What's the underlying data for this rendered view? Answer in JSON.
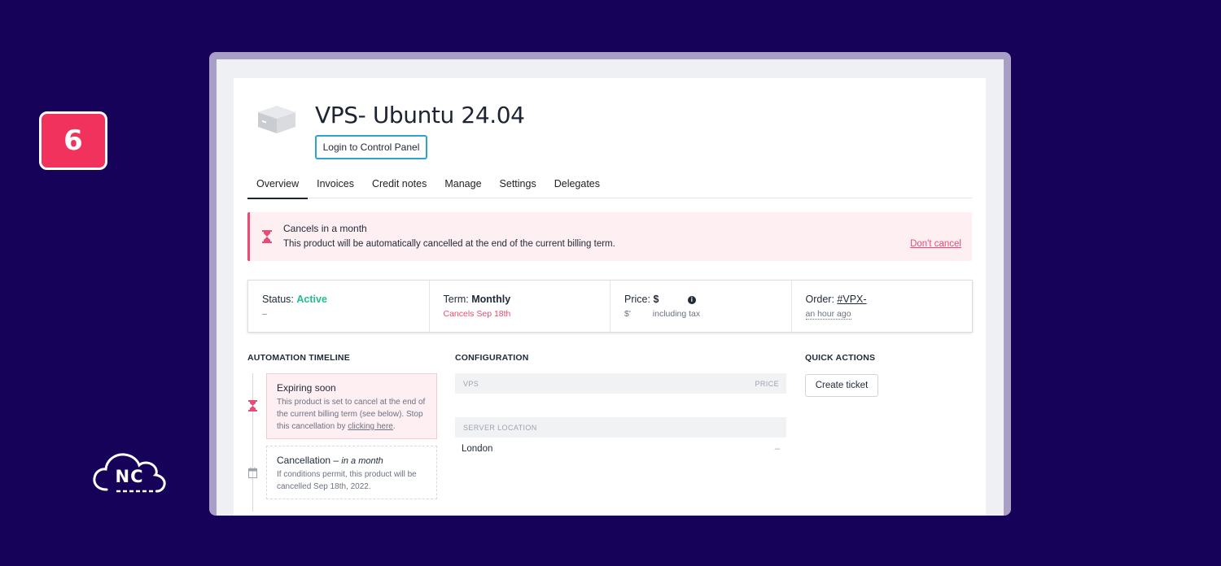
{
  "step_badge": "6",
  "brand_logo": "NC",
  "colors": {
    "background": "#160258",
    "badge": "#f0325c",
    "accent_pink": "#e84b75",
    "status_green": "#1fbf8f",
    "button_border": "#2aa5cf"
  },
  "product": {
    "title": "VPS- Ubuntu 24.04",
    "login_button": "Login to Control Panel",
    "image_icon": "server-box-icon"
  },
  "tabs": [
    "Overview",
    "Invoices",
    "Credit notes",
    "Manage",
    "Settings",
    "Delegates"
  ],
  "active_tab": "Overview",
  "alert": {
    "icon": "hourglass-icon",
    "title": "Cancels in a month",
    "text": "This product will be automatically cancelled at the end of the current billing term.",
    "link": "Don't cancel"
  },
  "stats": {
    "status_label": "Status:",
    "status_value": "Active",
    "status_sub": "–",
    "term_label": "Term:",
    "term_value": "Monthly",
    "term_sub": "Cancels Sep 18th",
    "price_label": "Price:",
    "price_value": "$",
    "price_sub_currency": "$'",
    "price_sub_tax": "including tax",
    "order_label": "Order:",
    "order_value": "#VPX-",
    "order_sub": "an hour ago"
  },
  "automation": {
    "heading": "AUTOMATION TIMELINE",
    "items": [
      {
        "title": "Expiring soon",
        "text": "This product is set to cancel at the end of the current billing term (see below). Stop this cancellation by",
        "link": "clicking here",
        "suffix": "."
      },
      {
        "title": "Cancellation –",
        "title_em": "in a month",
        "text": "If conditions permit, this product will be cancelled Sep 18th, 2022."
      }
    ]
  },
  "configuration": {
    "heading": "CONFIGURATION",
    "header_left": "VPS",
    "header_right": "PRICE",
    "location_header": "SERVER LOCATION",
    "location_value": "London",
    "location_price": "–"
  },
  "quick_actions": {
    "heading": "QUICK ACTIONS",
    "button": "Create ticket"
  }
}
